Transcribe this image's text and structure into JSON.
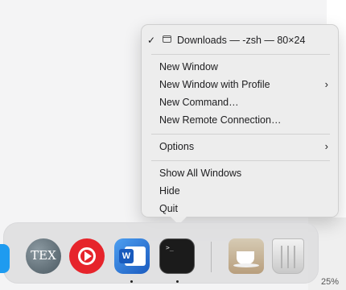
{
  "menu": {
    "current_window": {
      "check": "✓",
      "title": "Downloads — -zsh — 80×24"
    },
    "items": [
      {
        "label": "New Window"
      },
      {
        "label": "New Window with Profile",
        "submenu": "›"
      },
      {
        "label": "New Command…"
      },
      {
        "label": "New Remote Connection…"
      },
      {
        "label": "Options",
        "submenu": "›"
      },
      {
        "label": "Show All Windows"
      },
      {
        "label": "Hide"
      },
      {
        "label": "Quit"
      }
    ]
  },
  "dock": {
    "apps": [
      {
        "name": "app-partial-icon"
      },
      {
        "name": "tex-icon",
        "glyph": "TEX"
      },
      {
        "name": "youtube-music-icon"
      },
      {
        "name": "word-icon",
        "glyph": "W"
      },
      {
        "name": "terminal-icon",
        "glyph": ">_"
      },
      {
        "name": "coffee-icon"
      },
      {
        "name": "trash-icon"
      }
    ]
  },
  "zoom_label": "25%"
}
